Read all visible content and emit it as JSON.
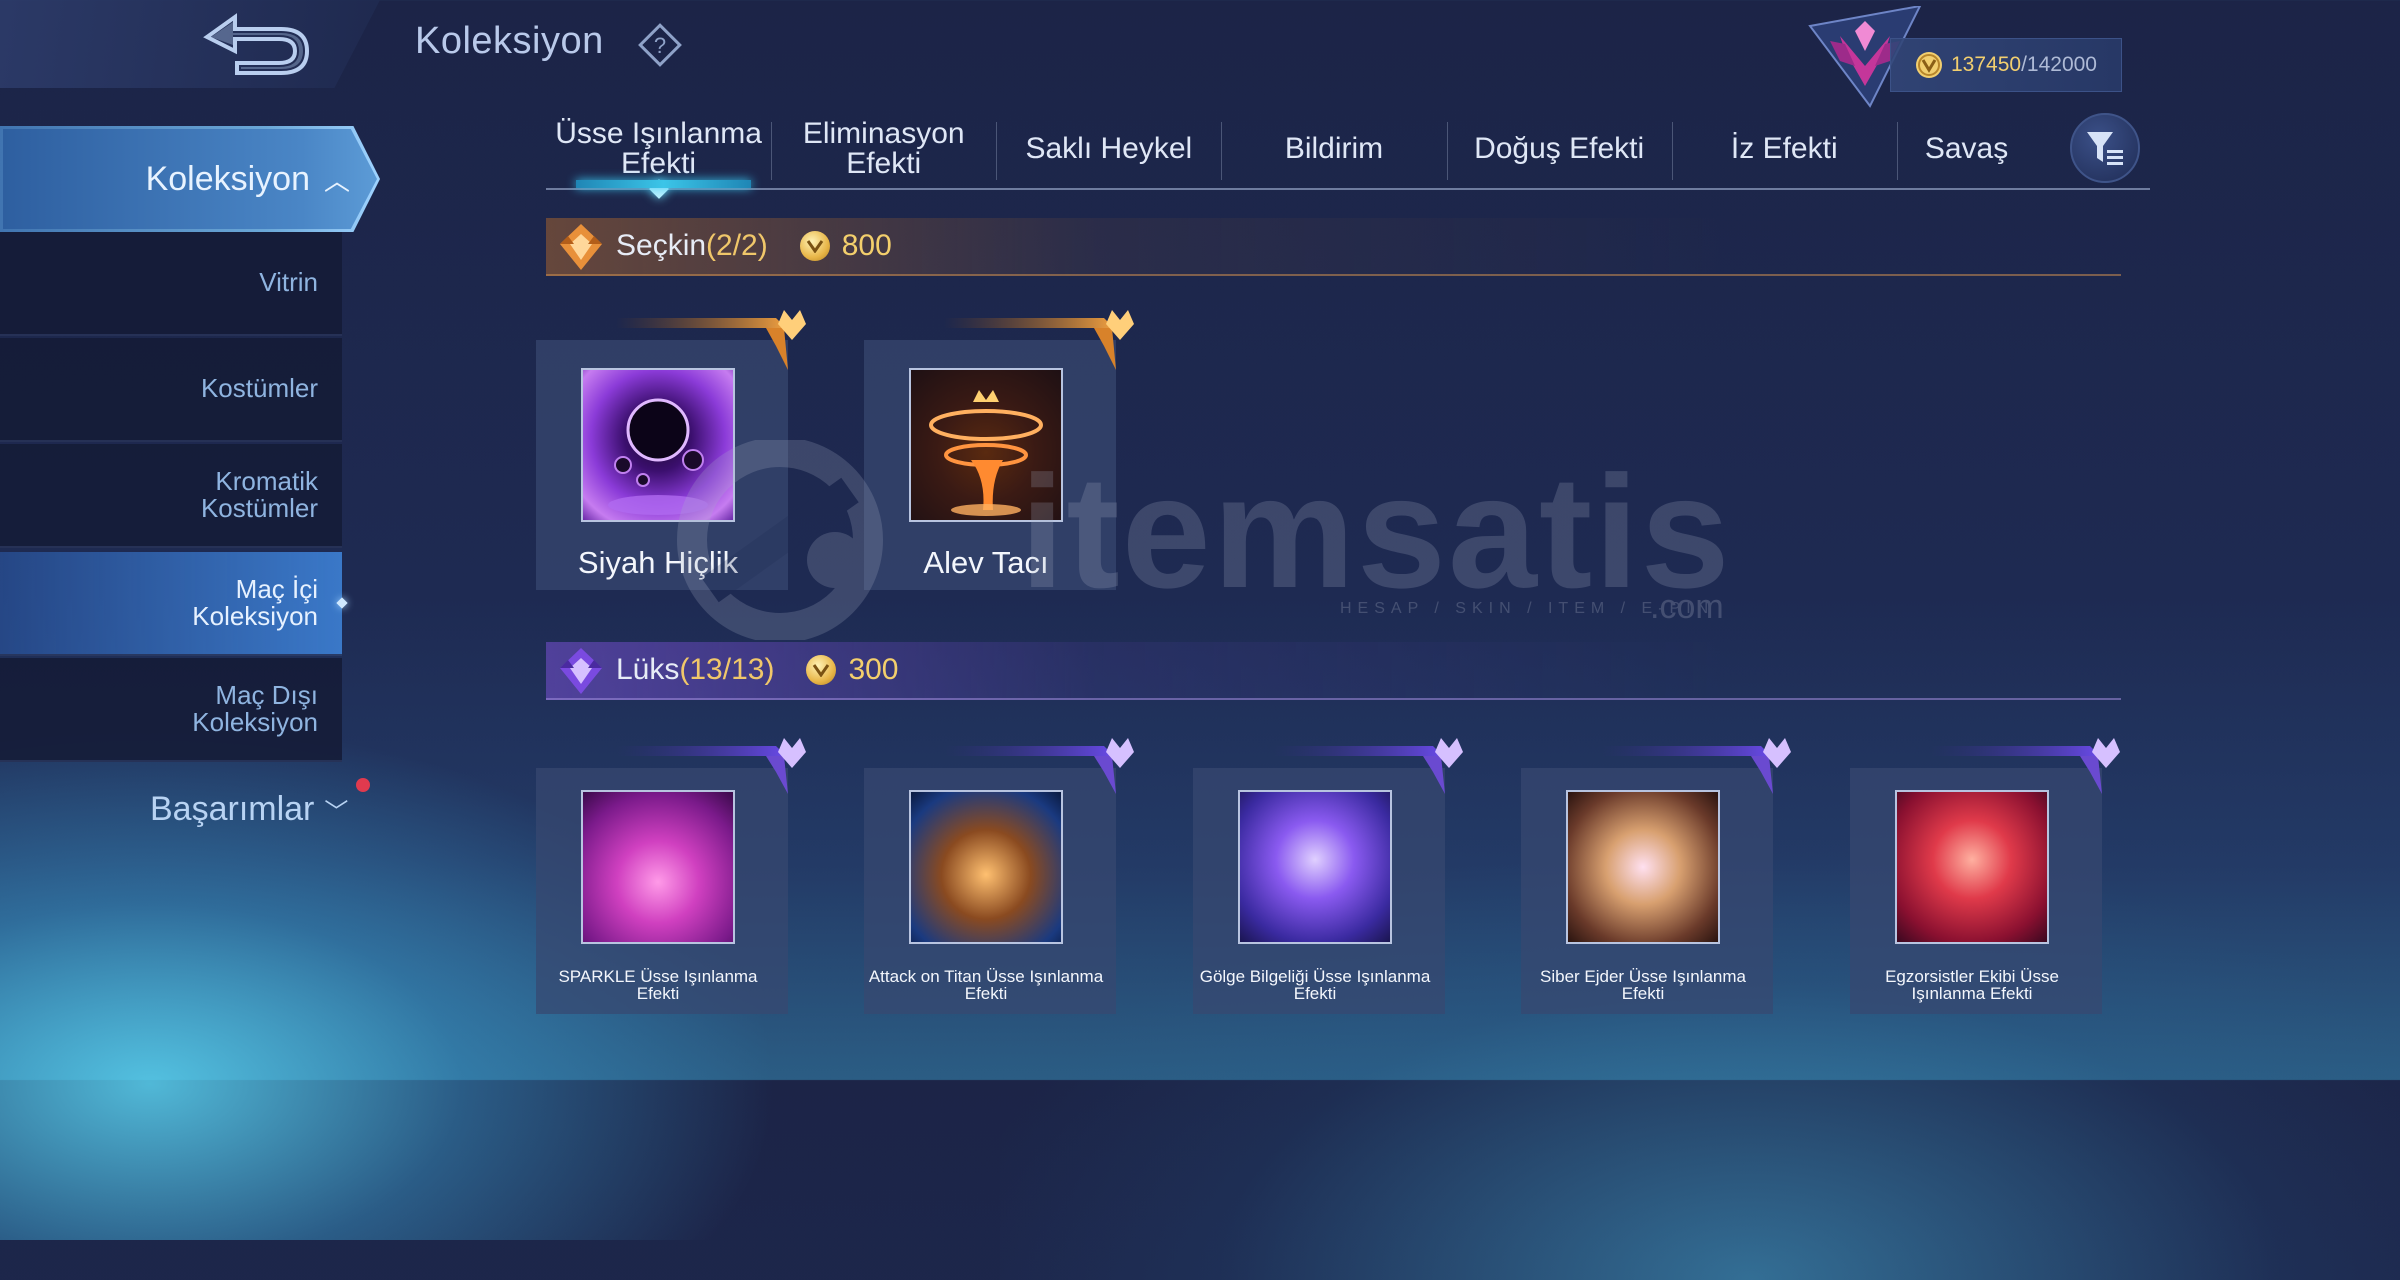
{
  "header": {
    "title": "Koleksiyon",
    "help_label": "?",
    "currency": {
      "current": "137450",
      "max": "/142000"
    }
  },
  "sidebar": {
    "active": "Koleksiyon",
    "items": [
      {
        "label": "Vitrin"
      },
      {
        "label": "Kostümler"
      },
      {
        "label": "Kromatik\nKostümler"
      },
      {
        "label": "Maç İçi\nKoleksiyon"
      },
      {
        "label": "Maç Dışı\nKoleksiyon"
      }
    ],
    "achievements": "Başarımlar"
  },
  "tabs": [
    {
      "label": "Üsse Işınlanma Efekti"
    },
    {
      "label": "Eliminasyon Efekti"
    },
    {
      "label": "Saklı Heykel"
    },
    {
      "label": "Bildirim"
    },
    {
      "label": "Doğuş Efekti"
    },
    {
      "label": "İz Efekti"
    },
    {
      "label": "Savaş"
    }
  ],
  "sections": {
    "elite": {
      "name": "Seçkin",
      "count": "(2/2)",
      "points": "800"
    },
    "lux": {
      "name": "Lüks",
      "count": "(13/13)",
      "points": "300"
    }
  },
  "elite_items": [
    {
      "name": "Siyah Hiçlik"
    },
    {
      "name": "Alev Tacı"
    }
  ],
  "lux_items": [
    {
      "name": "SPARKLE Üsse Işınlanma Efekti"
    },
    {
      "name": "Attack on Titan Üsse Işınlanma Efekti"
    },
    {
      "name": "Gölge Bilgeliği Üsse Işınlanma Efekti"
    },
    {
      "name": "Siber Ejder Üsse Işınlanma Efekti"
    },
    {
      "name": "Egzorsistler Ekibi Üsse Işınlanma Efekti"
    }
  ],
  "watermark": {
    "brand": "itemsatis",
    "tagline": "HESAP / SKIN / ITEM / E-PIN",
    "domain": ".com"
  },
  "colors": {
    "accent_gold": "#f0c76a",
    "tab_active": "#3bc5e8",
    "sidebar_selected": "#3a78c8"
  }
}
